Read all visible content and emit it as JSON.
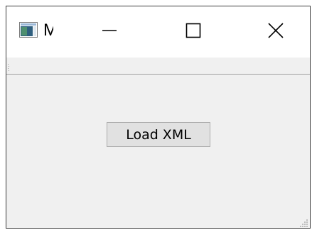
{
  "window": {
    "title": "M",
    "icons": {
      "app": "app-window-icon",
      "minimize": "minimize-icon",
      "maximize": "maximize-icon",
      "close": "close-icon"
    }
  },
  "content": {
    "load_button_label": "Load XML"
  }
}
